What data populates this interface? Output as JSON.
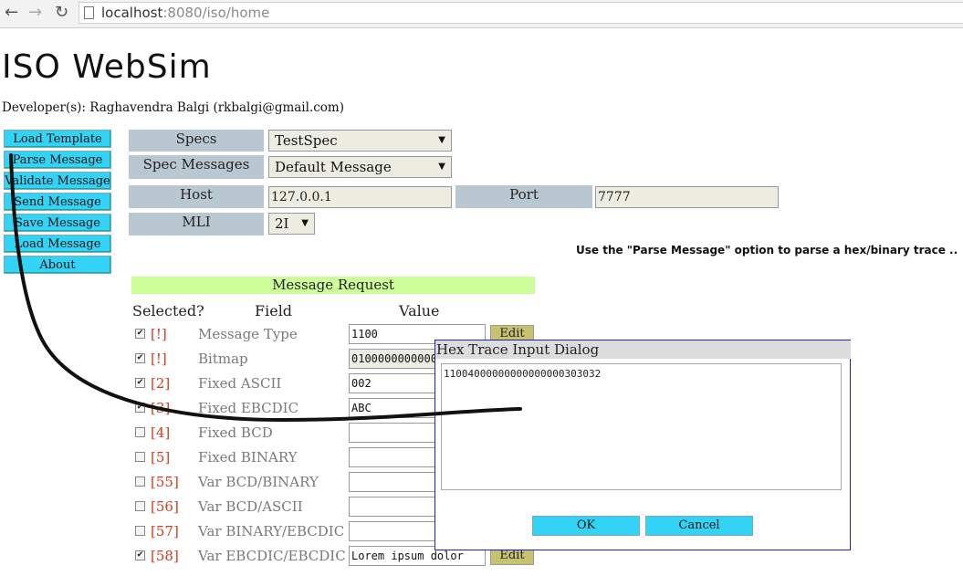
{
  "browser": {
    "back_icon": "back-arrow-icon",
    "forward_icon": "forward-arrow-icon",
    "reload_icon": "reload-icon",
    "url_host": "localhost",
    "url_rest": ":8080/iso/home"
  },
  "app": {
    "title": "ISO WebSim",
    "developer": "Developer(s): Raghavendra Balgi (rkbalgi@gmail.com)"
  },
  "sidebar": {
    "items": [
      {
        "label": "Load Template"
      },
      {
        "label": "Parse Message"
      },
      {
        "label": "Validate Message"
      },
      {
        "label": "Send Message"
      },
      {
        "label": "Save Message"
      },
      {
        "label": "Load Message"
      },
      {
        "label": "About"
      }
    ]
  },
  "form": {
    "specs_label": "Specs",
    "specs_value": "TestSpec",
    "spec_messages_label": "Spec Messages",
    "spec_messages_value": "Default Message",
    "host_label": "Host",
    "host_value": "127.0.0.1",
    "port_label": "Port",
    "port_value": "7777",
    "mli_label": "MLI",
    "mli_value": "2I",
    "hint": "Use the \"Parse Message\" option to parse a hex/binary trace .."
  },
  "message_request": {
    "header": "Message Request",
    "col_selected": "Selected?",
    "col_field": "Field",
    "col_value": "Value",
    "edit_label": "Edit",
    "rows": [
      {
        "checked": true,
        "id": "[!]",
        "field": "Message Type",
        "value": "1100"
      },
      {
        "checked": true,
        "id": "[!]",
        "field": "Bitmap",
        "value": "0100000000000000"
      },
      {
        "checked": true,
        "id": "[2]",
        "field": "Fixed ASCII",
        "value": "002"
      },
      {
        "checked": true,
        "id": "[3]",
        "field": "Fixed EBCDIC",
        "value": "ABC"
      },
      {
        "checked": false,
        "id": "[4]",
        "field": "Fixed BCD",
        "value": ""
      },
      {
        "checked": false,
        "id": "[5]",
        "field": "Fixed BINARY",
        "value": ""
      },
      {
        "checked": false,
        "id": "[55]",
        "field": "Var BCD/BINARY",
        "value": ""
      },
      {
        "checked": false,
        "id": "[56]",
        "field": "Var BCD/ASCII",
        "value": ""
      },
      {
        "checked": false,
        "id": "[57]",
        "field": "Var BINARY/EBCDIC",
        "value": ""
      },
      {
        "checked": true,
        "id": "[58]",
        "field": "Var EBCDIC/EBCDIC",
        "value": "Lorem ipsum dolor"
      }
    ]
  },
  "dialog": {
    "title": "Hex Trace Input Dialog",
    "content": "11004000000000000000303032",
    "ok_label": "OK",
    "cancel_label": "Cancel"
  }
}
